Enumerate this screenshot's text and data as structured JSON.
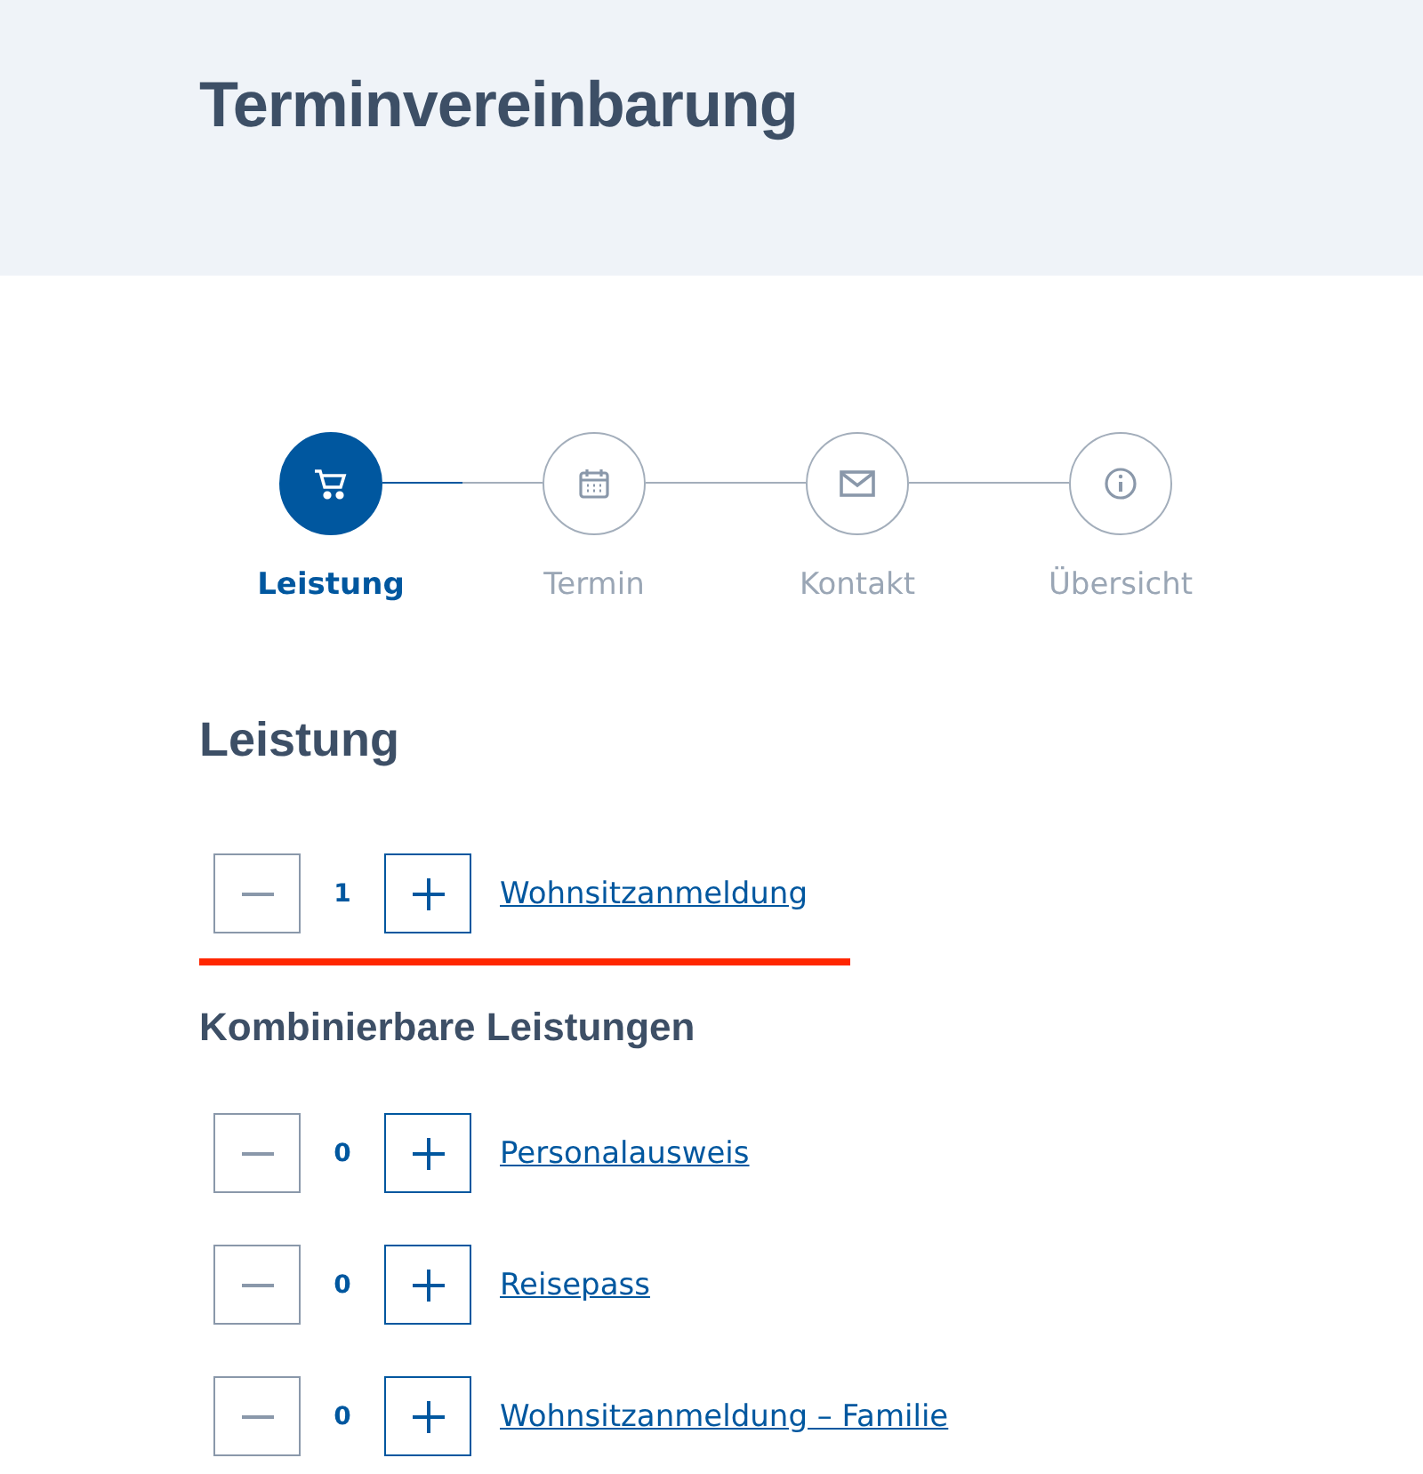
{
  "header": {
    "title": "Terminvereinbarung"
  },
  "steps": [
    {
      "label": "Leistung",
      "kind": "cart",
      "selected": true
    },
    {
      "label": "Termin",
      "kind": "calendar",
      "selected": false
    },
    {
      "label": "Kontakt",
      "kind": "mail",
      "selected": false
    },
    {
      "label": "Übersicht",
      "kind": "info",
      "selected": false
    }
  ],
  "service_section": {
    "heading": "Leistung",
    "items": [
      {
        "count": "1",
        "name": "Wohnsitzanmeldung",
        "highlighted": true
      }
    ]
  },
  "combinable_section": {
    "heading": "Kombinierbare Leistungen",
    "items": [
      {
        "count": "0",
        "name": "Personalausweis",
        "highlighted": false
      },
      {
        "count": "0",
        "name": "Reisepass",
        "highlighted": false
      },
      {
        "count": "0",
        "name": "Wohnsitzanmeldung – Familie",
        "highlighted": false
      }
    ]
  }
}
